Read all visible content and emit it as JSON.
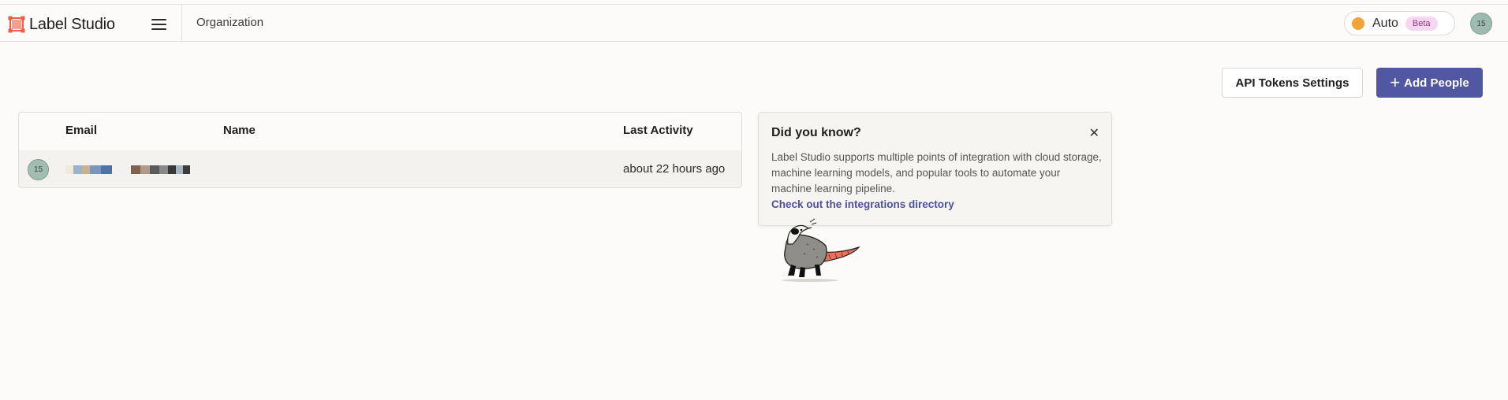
{
  "app": {
    "title": "Label Studio",
    "logo_icon": "label-studio-logo-icon",
    "brand_color": "#e8614a"
  },
  "header": {
    "menu_icon": "hamburger-menu-icon",
    "breadcrumb": "Organization",
    "theme": {
      "label": "Auto",
      "badge": "Beta",
      "dot_color": "#f2a33a"
    },
    "user_initials": "15"
  },
  "actions": {
    "api_tokens_label": "API Tokens Settings",
    "add_people_label": "Add People",
    "add_icon": "plus-icon",
    "accent_color": "#5157a3"
  },
  "table": {
    "columns": [
      "Email",
      "Name",
      "Last Activity"
    ],
    "rows": [
      {
        "avatar": "15",
        "email": "",
        "name": "",
        "last_activity": "about 22 hours ago"
      }
    ]
  },
  "tip": {
    "title": "Did you know?",
    "close_icon": "close-icon",
    "body": "Label Studio supports multiple points of integration with cloud storage, machine learning models, and popular tools to automate your machine learning pipeline.",
    "link": "Check out the integrations directory",
    "illustration": "opossum-illustration"
  }
}
